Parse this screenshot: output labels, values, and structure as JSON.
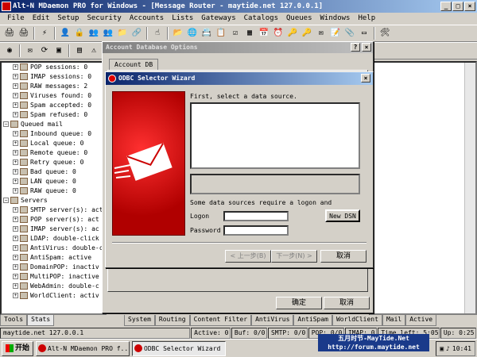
{
  "window": {
    "title": "Alt-N MDaemon PRO for Windows - [Message Router - maytide.net 127.0.0.1]",
    "controls": [
      "_",
      "□",
      "×"
    ]
  },
  "menu": [
    "File",
    "Edit",
    "Setup",
    "Security",
    "Accounts",
    "Lists",
    "Gateways",
    "Catalogs",
    "Queues",
    "Windows",
    "Help"
  ],
  "tree": [
    {
      "label": "POP sessions: 0",
      "indent": 2
    },
    {
      "label": "IMAP sessions: 0",
      "indent": 2
    },
    {
      "label": "RAW messages: 2",
      "indent": 2
    },
    {
      "label": "Viruses found: 0",
      "indent": 2
    },
    {
      "label": "Spam accepted: 0",
      "indent": 2
    },
    {
      "label": "Spam refused: 0",
      "indent": 2
    },
    {
      "label": "Queued mail",
      "indent": 1
    },
    {
      "label": "Inbound queue: 0",
      "indent": 2
    },
    {
      "label": "Local queue: 0",
      "indent": 2
    },
    {
      "label": "Remote queue: 0",
      "indent": 2
    },
    {
      "label": "Retry queue: 0",
      "indent": 2
    },
    {
      "label": "Bad queue: 0",
      "indent": 2
    },
    {
      "label": "LAN queue: 0",
      "indent": 2
    },
    {
      "label": "RAW queue: 0",
      "indent": 2
    },
    {
      "label": "Servers",
      "indent": 1
    },
    {
      "label": "SMTP server(s): act",
      "indent": 2
    },
    {
      "label": "POP server(s): act",
      "indent": 2
    },
    {
      "label": "IMAP server(s): ac",
      "indent": 2
    },
    {
      "label": "LDAP: double-click",
      "indent": 2
    },
    {
      "label": "AntiVirus: double-c",
      "indent": 2
    },
    {
      "label": "AntiSpam: active",
      "indent": 2
    },
    {
      "label": "DomainPOP: inactiv",
      "indent": 2
    },
    {
      "label": "MultiPOP: inactive",
      "indent": 2
    },
    {
      "label": "WebAdmin: double-c",
      "indent": 2
    },
    {
      "label": "WorldClient: activ",
      "indent": 2
    }
  ],
  "account_db_dialog": {
    "title": "Account Database Options",
    "help": "?",
    "close": "×",
    "tab": "Account DB",
    "ok": "确定",
    "cancel": "取消"
  },
  "odbc_wizard": {
    "title": "ODBC Selector Wizard",
    "close": "×",
    "prompt": "First, select a data source.",
    "logon_note": "Some data sources require a logon and",
    "logon_label": "Logon",
    "password_label": "Password",
    "new_dsn": "New DSN",
    "back": "< 上一步(B)",
    "next": "下一步(N) >",
    "cancel": "取消"
  },
  "left_tabs": [
    "Tools",
    "Stats"
  ],
  "bottom_tabs": [
    "System",
    "Routing",
    "Content Filter",
    "AntiVirus",
    "AntiSpam",
    "WorldClient",
    "Mail",
    "Active"
  ],
  "status": [
    "maytide.net 127.0.0.1",
    "Active: 0",
    "Buf: 0/0",
    "SMTP: 0/0",
    "POP: 0/0",
    "IMAP: 0",
    "Time left: 5:05",
    "Up: 0:25"
  ],
  "taskbar": {
    "start": "开始",
    "tasks": [
      "Alt-N MDaemon PRO f...",
      "ODBC Selector Wizard"
    ],
    "clock": "10:41"
  },
  "watermark": [
    "五月时节-MayTide.Net",
    "http://forum.maytide.net"
  ],
  "colors": {
    "title_active": "#0a246a",
    "title_inactive": "#808080",
    "wizard_image": "#c00000"
  }
}
